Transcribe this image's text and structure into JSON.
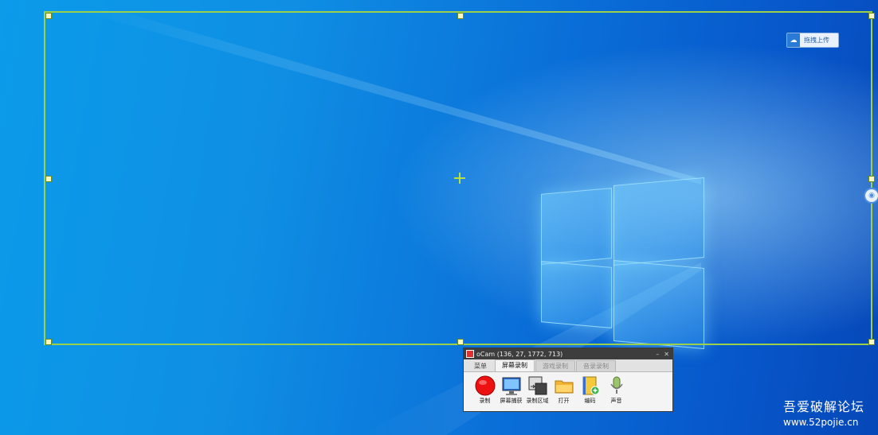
{
  "upload_button": {
    "label": "拖拽上传",
    "icon": "cloud-upload-icon"
  },
  "ocam": {
    "title": "oCam (136, 27, 1772, 713)",
    "tabs": [
      {
        "label": "菜单"
      },
      {
        "label": "屏幕录制"
      },
      {
        "label": "游戏录制"
      },
      {
        "label": "音录录制"
      }
    ],
    "tools": [
      {
        "label": "录制",
        "icon": "record-icon"
      },
      {
        "label": "屏幕捕获",
        "icon": "screen-capture-icon"
      },
      {
        "label": "录制区域",
        "icon": "record-area-icon"
      },
      {
        "label": "打开",
        "icon": "folder-open-icon"
      },
      {
        "label": "编码",
        "icon": "codec-icon"
      },
      {
        "label": "声音",
        "icon": "microphone-icon"
      }
    ]
  },
  "watermark": {
    "name": "吾爱破解论坛",
    "url": "www.52pojie.cn"
  },
  "colors": {
    "selection": "#9bd14a",
    "desktop": "#0a7de0"
  }
}
